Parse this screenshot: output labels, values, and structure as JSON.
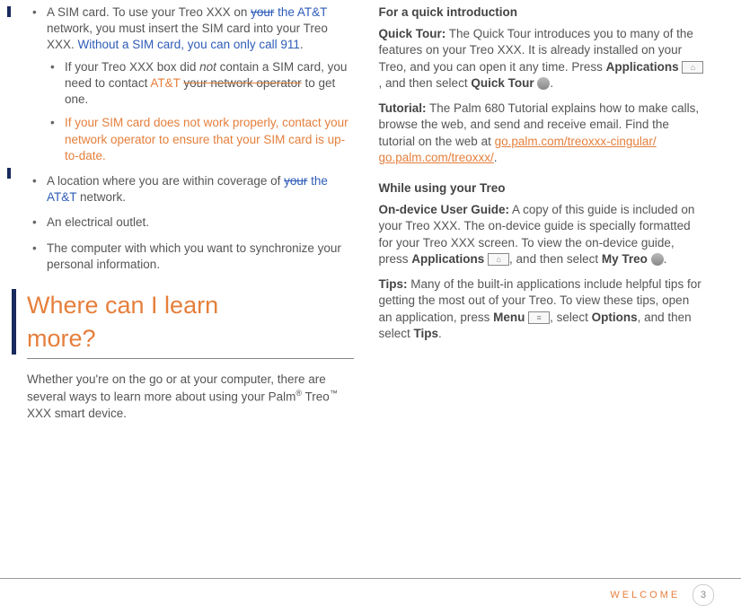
{
  "left": {
    "item1": {
      "a": "A SIM card. To use your Treo XXX on ",
      "b": "your",
      "c": " the AT&T",
      "d": " network, you must insert the SIM card into your Treo XXX. ",
      "e": "Without a SIM card, you can only call 911",
      "f": "."
    },
    "sub1": {
      "a": "If your Treo XXX box did ",
      "b": "not",
      "c": " contain a SIM card, you need to contact ",
      "d": "AT&T",
      "e": "your network operator",
      "f": " to get one."
    },
    "sub2": "If your SIM card does not work properly, contact your network operator to ensure that your SIM card is up-to-date.",
    "item2": {
      "a": "A location where you are within coverage of ",
      "b": "your",
      "c": " the AT&T",
      "d": " network."
    },
    "item3": "An electrical outlet.",
    "item4": "The computer with which you want to synchronize your personal information.",
    "heading_l1": "Where can I learn",
    "heading_l2": "more?",
    "para": {
      "a": "Whether you're on the go or at your computer, there are several ways to learn more about using your Palm",
      "b": "®",
      "c": " Treo",
      "d": "™",
      "e": " XXX smart device."
    }
  },
  "right": {
    "sub1": "For a quick introduction",
    "qt": {
      "label": "Quick Tour:",
      "a": " The Quick Tour introduces you to many of the features on your Treo XXX. It is already installed on your Treo, and you can open it any time. Press ",
      "apps": "Applications",
      "b": ", and then select ",
      "qtlabel": "Quick Tour",
      "c": "."
    },
    "tut": {
      "label": "Tutorial:",
      "a": " The Palm 680 Tutorial explains how to make calls, browse the web, and send and receive email. Find the tutorial on the web at ",
      "link1": "go.palm.com/treoxxx-cingular/",
      "link2": "go.palm.com/treoxxx/",
      "b": "."
    },
    "sub2": "While using your Treo",
    "ug": {
      "label": "On-device User Guide:",
      "a": " A copy of this guide is included on your Treo XXX. The on-device guide is specially formatted for your Treo XXX screen. To view the on-device guide, press ",
      "apps": "Applications",
      "b": ", and then select ",
      "mytreo": "My Treo",
      "c": "."
    },
    "tips": {
      "label": "Tips:",
      "a": " Many of the built-in applications include helpful tips for getting the most out of your Treo. To view these tips, open an application, press ",
      "menu": "Menu",
      "b": ", select ",
      "options": "Options",
      "c": ", and then select ",
      "tipsword": "Tips",
      "d": "."
    }
  },
  "footer": {
    "label": "WELCOME",
    "page": "3"
  }
}
